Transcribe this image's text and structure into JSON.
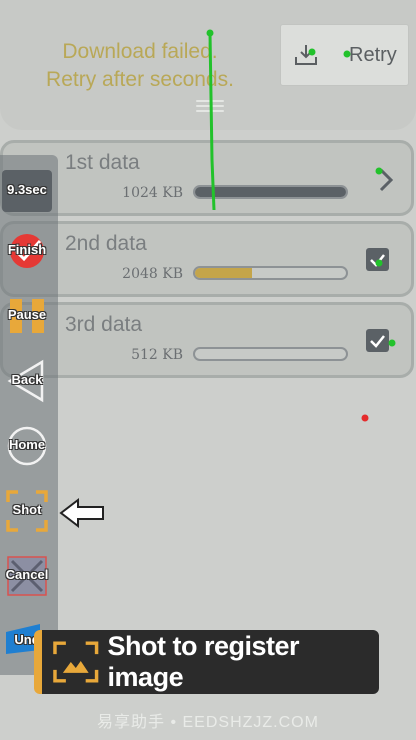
{
  "banner": {
    "status_line1": "Download failed.",
    "status_line2": "Retry after seconds.",
    "retry_label": "Retry"
  },
  "items": [
    {
      "title": "1st data",
      "size": "1024 KB",
      "progress": 1.0,
      "progress_color": "#5b6166",
      "control": "chevron"
    },
    {
      "title": "2nd data",
      "size": "2048 KB",
      "progress": 0.38,
      "progress_color": "#c4a54a",
      "control": "checkbox"
    },
    {
      "title": "3rd data",
      "size": "512 KB",
      "progress": 0.0,
      "progress_color": "#c4a54a",
      "control": "checkbox"
    }
  ],
  "toolbar": {
    "timer": "9.3sec",
    "finish": "Finish",
    "pause": "Pause",
    "back": "Back",
    "home": "Home",
    "shot": "Shot",
    "cancel": "Cancel",
    "undo": "Und"
  },
  "tooltip": {
    "text": "Shot to register image",
    "icon": "shot-frame-icon"
  },
  "watermark": "易享助手 • EEDSHZJZ.COM",
  "colors": {
    "accent": "#e8a83a",
    "status_text": "#b9a857",
    "finish_red": "#e53935",
    "gesture_green": "#22c22b"
  }
}
